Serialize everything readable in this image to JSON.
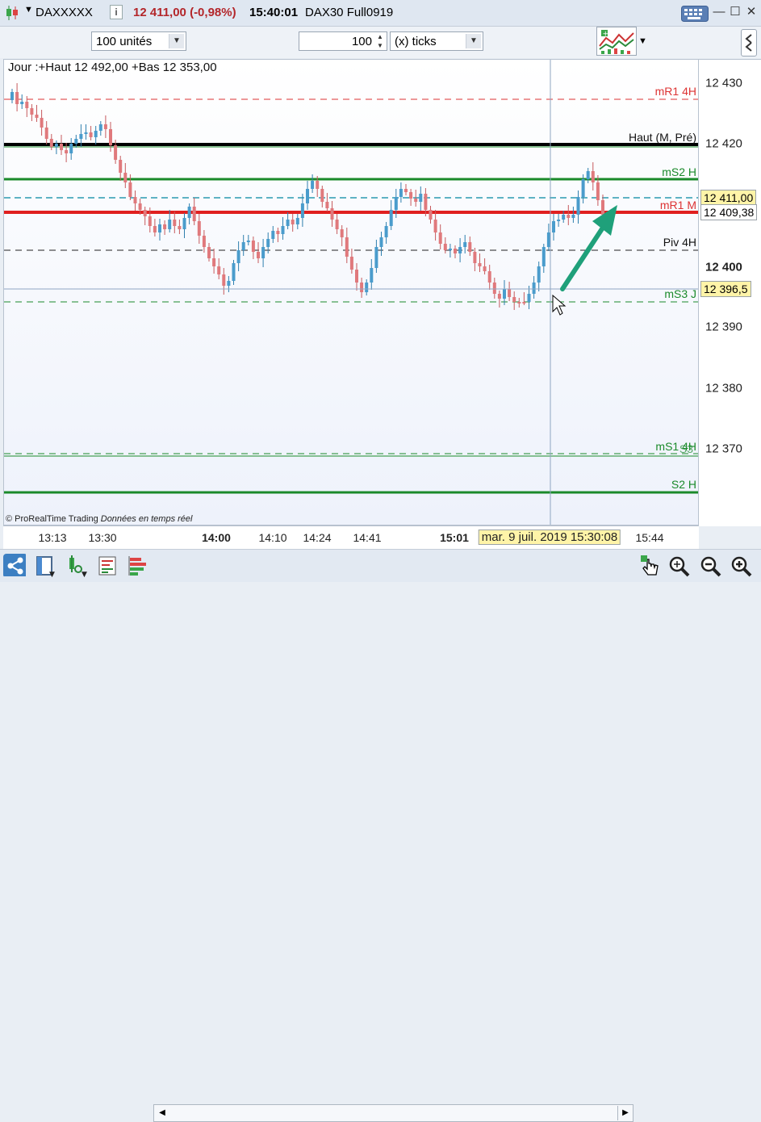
{
  "titlebar": {
    "symbol": "DAXXXXX",
    "price_change": "12 411,00 (-0,98%)",
    "time": "15:40:01",
    "instrument": "DAX30 Full0919"
  },
  "toolbar": {
    "units_select": "100 unités",
    "ticks_value": "100",
    "ticks_select": "(x) ticks"
  },
  "chart": {
    "info_line": "Jour :+Haut 12 492,00 +Bas 12 353,00",
    "copyright": "© ProRealTime Trading",
    "realtime": "Données en temps réel",
    "levels": {
      "mr1_4h": "mR1 4H",
      "haut": "Haut (M, Pré)",
      "ms2": "mS2 H",
      "mr1_m": "mR1 M",
      "piv_4h": "Piv 4H",
      "ms3_j": "mS3 J",
      "ms1": "mS1 4H",
      "s3": "S3",
      "s2": "S2 H"
    },
    "colors": {
      "up": "#4a9ccc",
      "down": "#e0797c",
      "arrow": "#1fa07a"
    }
  },
  "y_axis": {
    "labels": [
      "12 430",
      "12 420",
      "12 400",
      "12 390",
      "12 380",
      "12 370"
    ],
    "bold_label": "12 400",
    "current_price_tag": "12 411,00",
    "cursor_price_tag": "12 409,38",
    "ms3_tag": "12 396,5"
  },
  "x_axis": {
    "labels": [
      "13:13",
      "13:30",
      "14:00",
      "14:10",
      "14:24",
      "14:41",
      "15:01",
      "15:44"
    ],
    "cursor_date": "mar. 9 juil. 2019 15:30:08"
  }
}
